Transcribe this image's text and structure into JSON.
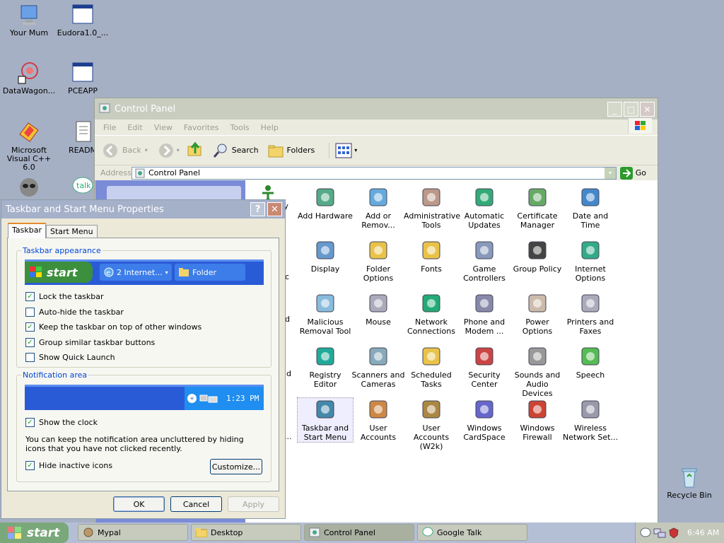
{
  "desktop": {
    "icons": [
      {
        "label": "Your Mum"
      },
      {
        "label": "Eudora1.0_..."
      },
      {
        "label": "DataWagon..."
      },
      {
        "label": "PCEAPP"
      },
      {
        "label": "Microsoft Visual C++ 6.0"
      },
      {
        "label": "READM"
      },
      {
        "label": "Recycle Bin"
      }
    ]
  },
  "control_panel": {
    "title": "Control Panel",
    "menu": [
      "File",
      "Edit",
      "View",
      "Favorites",
      "Tools",
      "Help"
    ],
    "toolbar": {
      "back": "Back",
      "search": "Search",
      "folders": "Folders"
    },
    "address": {
      "label": "Address",
      "value": "Control Panel",
      "go": "Go"
    },
    "left_pane_fragments": [
      "ty",
      "c",
      "d",
      "nd",
      "..."
    ],
    "items": [
      {
        "label": "Add Hardware"
      },
      {
        "label": "Add or Remov..."
      },
      {
        "label": "Administrative Tools"
      },
      {
        "label": "Automatic Updates"
      },
      {
        "label": "Certificate Manager"
      },
      {
        "label": "Date and Time"
      },
      {
        "label": "Display"
      },
      {
        "label": "Folder Options"
      },
      {
        "label": "Fonts"
      },
      {
        "label": "Game Controllers"
      },
      {
        "label": "Group Policy"
      },
      {
        "label": "Internet Options"
      },
      {
        "label": "Malicious Removal Tool"
      },
      {
        "label": "Mouse"
      },
      {
        "label": "Network Connections"
      },
      {
        "label": "Phone and Modem ..."
      },
      {
        "label": "Power Options"
      },
      {
        "label": "Printers and Faxes"
      },
      {
        "label": "Registry Editor"
      },
      {
        "label": "Scanners and Cameras"
      },
      {
        "label": "Scheduled Tasks"
      },
      {
        "label": "Security Center"
      },
      {
        "label": "Sounds and Audio Devices"
      },
      {
        "label": "Speech"
      },
      {
        "label": "Taskbar and Start Menu"
      },
      {
        "label": "User Accounts"
      },
      {
        "label": "User Accounts (W2k)"
      },
      {
        "label": "Windows CardSpace"
      },
      {
        "label": "Windows Firewall"
      },
      {
        "label": "Wireless Network Set..."
      }
    ]
  },
  "dialog": {
    "title": "Taskbar and Start Menu Properties",
    "help_button": "?",
    "close_button": "✕",
    "tabs": [
      "Taskbar",
      "Start Menu"
    ],
    "appearance": {
      "label": "Taskbar appearance",
      "preview_start": "start",
      "preview_item1": "2 Internet...",
      "preview_item2": "Folder",
      "options": [
        {
          "label": "Lock the taskbar",
          "checked": true
        },
        {
          "label": "Auto-hide the taskbar",
          "checked": false
        },
        {
          "label": "Keep the taskbar on top of other windows",
          "checked": true
        },
        {
          "label": "Group similar taskbar buttons",
          "checked": true
        },
        {
          "label": "Show Quick Launch",
          "checked": false
        }
      ]
    },
    "notification": {
      "label": "Notification area",
      "preview_time": "1:23 PM",
      "show_clock": "Show the clock",
      "description": "You can keep the notification area uncluttered by hiding icons that you have not clicked recently.",
      "hide_inactive": "Hide inactive icons",
      "customize": "Customize..."
    },
    "ok": "OK",
    "cancel": "Cancel",
    "apply": "Apply"
  },
  "taskbar": {
    "start": "start",
    "items": [
      {
        "label": "Mypal"
      },
      {
        "label": "Desktop"
      },
      {
        "label": "Control Panel"
      },
      {
        "label": "Google Talk"
      }
    ],
    "clock": "6:46 AM"
  },
  "colors": {
    "desktop": "#a6b0c4",
    "xp_blue": "#2a5bd7",
    "start_green": "#3c8f3c",
    "group_label": "#0046d5"
  }
}
